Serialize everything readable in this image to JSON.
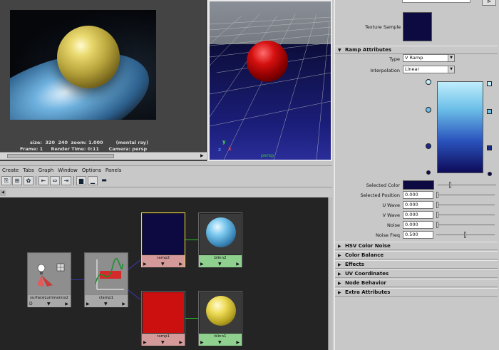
{
  "render_view": {
    "info_line1": "size:  320  240  zoom: 1.000        (mental ray)",
    "info_line2": "Frame: 1     Render Time: 0:11      Camera: persp"
  },
  "viewport": {
    "camera_label": "persp",
    "axis_x": "x",
    "axis_y": "y",
    "axis_z": "z"
  },
  "hypershade": {
    "menu": [
      "Create",
      "Tabs",
      "Graph",
      "Window",
      "Options",
      "Panels"
    ],
    "nodes": {
      "surface_luminance": {
        "name": "surfaceLuminance2"
      },
      "clamp": {
        "name": "clamp1"
      },
      "ramp2": {
        "name": "ramp2",
        "color": "#0c0a40"
      },
      "ramp1": {
        "name": "ramp1",
        "color": "#cc1010"
      },
      "blinn2": {
        "name": "blinn2"
      },
      "blinn1": {
        "name": "blinn1"
      }
    },
    "port_arrow": "▼",
    "port_left": "▶",
    "port_right": "▶",
    "port_out_left": "D"
  },
  "attribute_editor": {
    "top_button": "⊳",
    "texture_sample_label": "Texture Sample",
    "texture_sample_color": "#0c0a40",
    "ramp_attributes": {
      "header": "Ramp Attributes",
      "type_label": "Type",
      "type_value": "V Ramp",
      "interpolation_label": "Interpolation",
      "interpolation_value": "Linear",
      "selected_color_label": "Selected Color",
      "selected_color": "#0c0a40",
      "selected_position_label": "Selected Position",
      "selected_position": "0.000",
      "u_wave_label": "U Wave",
      "u_wave": "0.000",
      "v_wave_label": "V Wave",
      "v_wave": "0.000",
      "noise_label": "Noise",
      "noise": "0.000",
      "noise_freq_label": "Noise Freq",
      "noise_freq": "0.500",
      "selected_color_slider": 0.2,
      "noise_freq_slider": 0.5
    },
    "collapsed_sections": [
      "HSV Color Noise",
      "Color Balance",
      "Effects",
      "UV Coordinates",
      "Node Behavior",
      "Extra Attributes"
    ],
    "open_arrow": "▼",
    "closed_arrow": "▶"
  }
}
